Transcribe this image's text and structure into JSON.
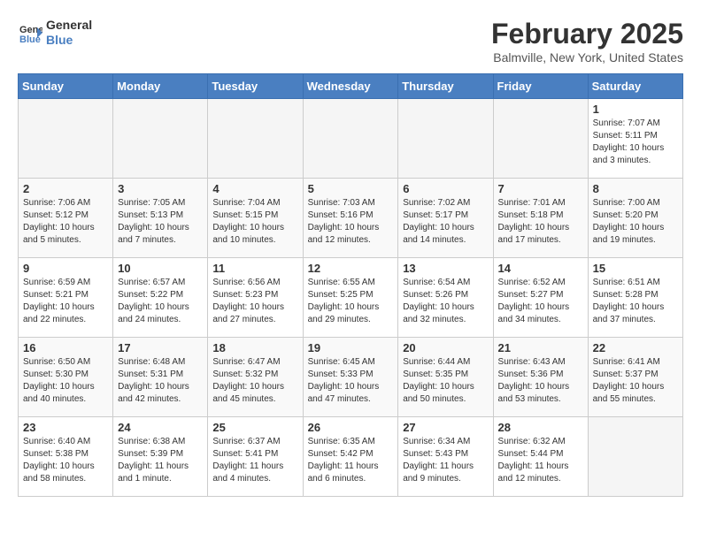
{
  "header": {
    "logo_line1": "General",
    "logo_line2": "Blue",
    "month_year": "February 2025",
    "location": "Balmville, New York, United States"
  },
  "weekdays": [
    "Sunday",
    "Monday",
    "Tuesday",
    "Wednesday",
    "Thursday",
    "Friday",
    "Saturday"
  ],
  "weeks": [
    [
      {
        "day": "",
        "info": ""
      },
      {
        "day": "",
        "info": ""
      },
      {
        "day": "",
        "info": ""
      },
      {
        "day": "",
        "info": ""
      },
      {
        "day": "",
        "info": ""
      },
      {
        "day": "",
        "info": ""
      },
      {
        "day": "1",
        "info": "Sunrise: 7:07 AM\nSunset: 5:11 PM\nDaylight: 10 hours\nand 3 minutes."
      }
    ],
    [
      {
        "day": "2",
        "info": "Sunrise: 7:06 AM\nSunset: 5:12 PM\nDaylight: 10 hours\nand 5 minutes."
      },
      {
        "day": "3",
        "info": "Sunrise: 7:05 AM\nSunset: 5:13 PM\nDaylight: 10 hours\nand 7 minutes."
      },
      {
        "day": "4",
        "info": "Sunrise: 7:04 AM\nSunset: 5:15 PM\nDaylight: 10 hours\nand 10 minutes."
      },
      {
        "day": "5",
        "info": "Sunrise: 7:03 AM\nSunset: 5:16 PM\nDaylight: 10 hours\nand 12 minutes."
      },
      {
        "day": "6",
        "info": "Sunrise: 7:02 AM\nSunset: 5:17 PM\nDaylight: 10 hours\nand 14 minutes."
      },
      {
        "day": "7",
        "info": "Sunrise: 7:01 AM\nSunset: 5:18 PM\nDaylight: 10 hours\nand 17 minutes."
      },
      {
        "day": "8",
        "info": "Sunrise: 7:00 AM\nSunset: 5:20 PM\nDaylight: 10 hours\nand 19 minutes."
      }
    ],
    [
      {
        "day": "9",
        "info": "Sunrise: 6:59 AM\nSunset: 5:21 PM\nDaylight: 10 hours\nand 22 minutes."
      },
      {
        "day": "10",
        "info": "Sunrise: 6:57 AM\nSunset: 5:22 PM\nDaylight: 10 hours\nand 24 minutes."
      },
      {
        "day": "11",
        "info": "Sunrise: 6:56 AM\nSunset: 5:23 PM\nDaylight: 10 hours\nand 27 minutes."
      },
      {
        "day": "12",
        "info": "Sunrise: 6:55 AM\nSunset: 5:25 PM\nDaylight: 10 hours\nand 29 minutes."
      },
      {
        "day": "13",
        "info": "Sunrise: 6:54 AM\nSunset: 5:26 PM\nDaylight: 10 hours\nand 32 minutes."
      },
      {
        "day": "14",
        "info": "Sunrise: 6:52 AM\nSunset: 5:27 PM\nDaylight: 10 hours\nand 34 minutes."
      },
      {
        "day": "15",
        "info": "Sunrise: 6:51 AM\nSunset: 5:28 PM\nDaylight: 10 hours\nand 37 minutes."
      }
    ],
    [
      {
        "day": "16",
        "info": "Sunrise: 6:50 AM\nSunset: 5:30 PM\nDaylight: 10 hours\nand 40 minutes."
      },
      {
        "day": "17",
        "info": "Sunrise: 6:48 AM\nSunset: 5:31 PM\nDaylight: 10 hours\nand 42 minutes."
      },
      {
        "day": "18",
        "info": "Sunrise: 6:47 AM\nSunset: 5:32 PM\nDaylight: 10 hours\nand 45 minutes."
      },
      {
        "day": "19",
        "info": "Sunrise: 6:45 AM\nSunset: 5:33 PM\nDaylight: 10 hours\nand 47 minutes."
      },
      {
        "day": "20",
        "info": "Sunrise: 6:44 AM\nSunset: 5:35 PM\nDaylight: 10 hours\nand 50 minutes."
      },
      {
        "day": "21",
        "info": "Sunrise: 6:43 AM\nSunset: 5:36 PM\nDaylight: 10 hours\nand 53 minutes."
      },
      {
        "day": "22",
        "info": "Sunrise: 6:41 AM\nSunset: 5:37 PM\nDaylight: 10 hours\nand 55 minutes."
      }
    ],
    [
      {
        "day": "23",
        "info": "Sunrise: 6:40 AM\nSunset: 5:38 PM\nDaylight: 10 hours\nand 58 minutes."
      },
      {
        "day": "24",
        "info": "Sunrise: 6:38 AM\nSunset: 5:39 PM\nDaylight: 11 hours\nand 1 minute."
      },
      {
        "day": "25",
        "info": "Sunrise: 6:37 AM\nSunset: 5:41 PM\nDaylight: 11 hours\nand 4 minutes."
      },
      {
        "day": "26",
        "info": "Sunrise: 6:35 AM\nSunset: 5:42 PM\nDaylight: 11 hours\nand 6 minutes."
      },
      {
        "day": "27",
        "info": "Sunrise: 6:34 AM\nSunset: 5:43 PM\nDaylight: 11 hours\nand 9 minutes."
      },
      {
        "day": "28",
        "info": "Sunrise: 6:32 AM\nSunset: 5:44 PM\nDaylight: 11 hours\nand 12 minutes."
      },
      {
        "day": "",
        "info": ""
      }
    ]
  ]
}
